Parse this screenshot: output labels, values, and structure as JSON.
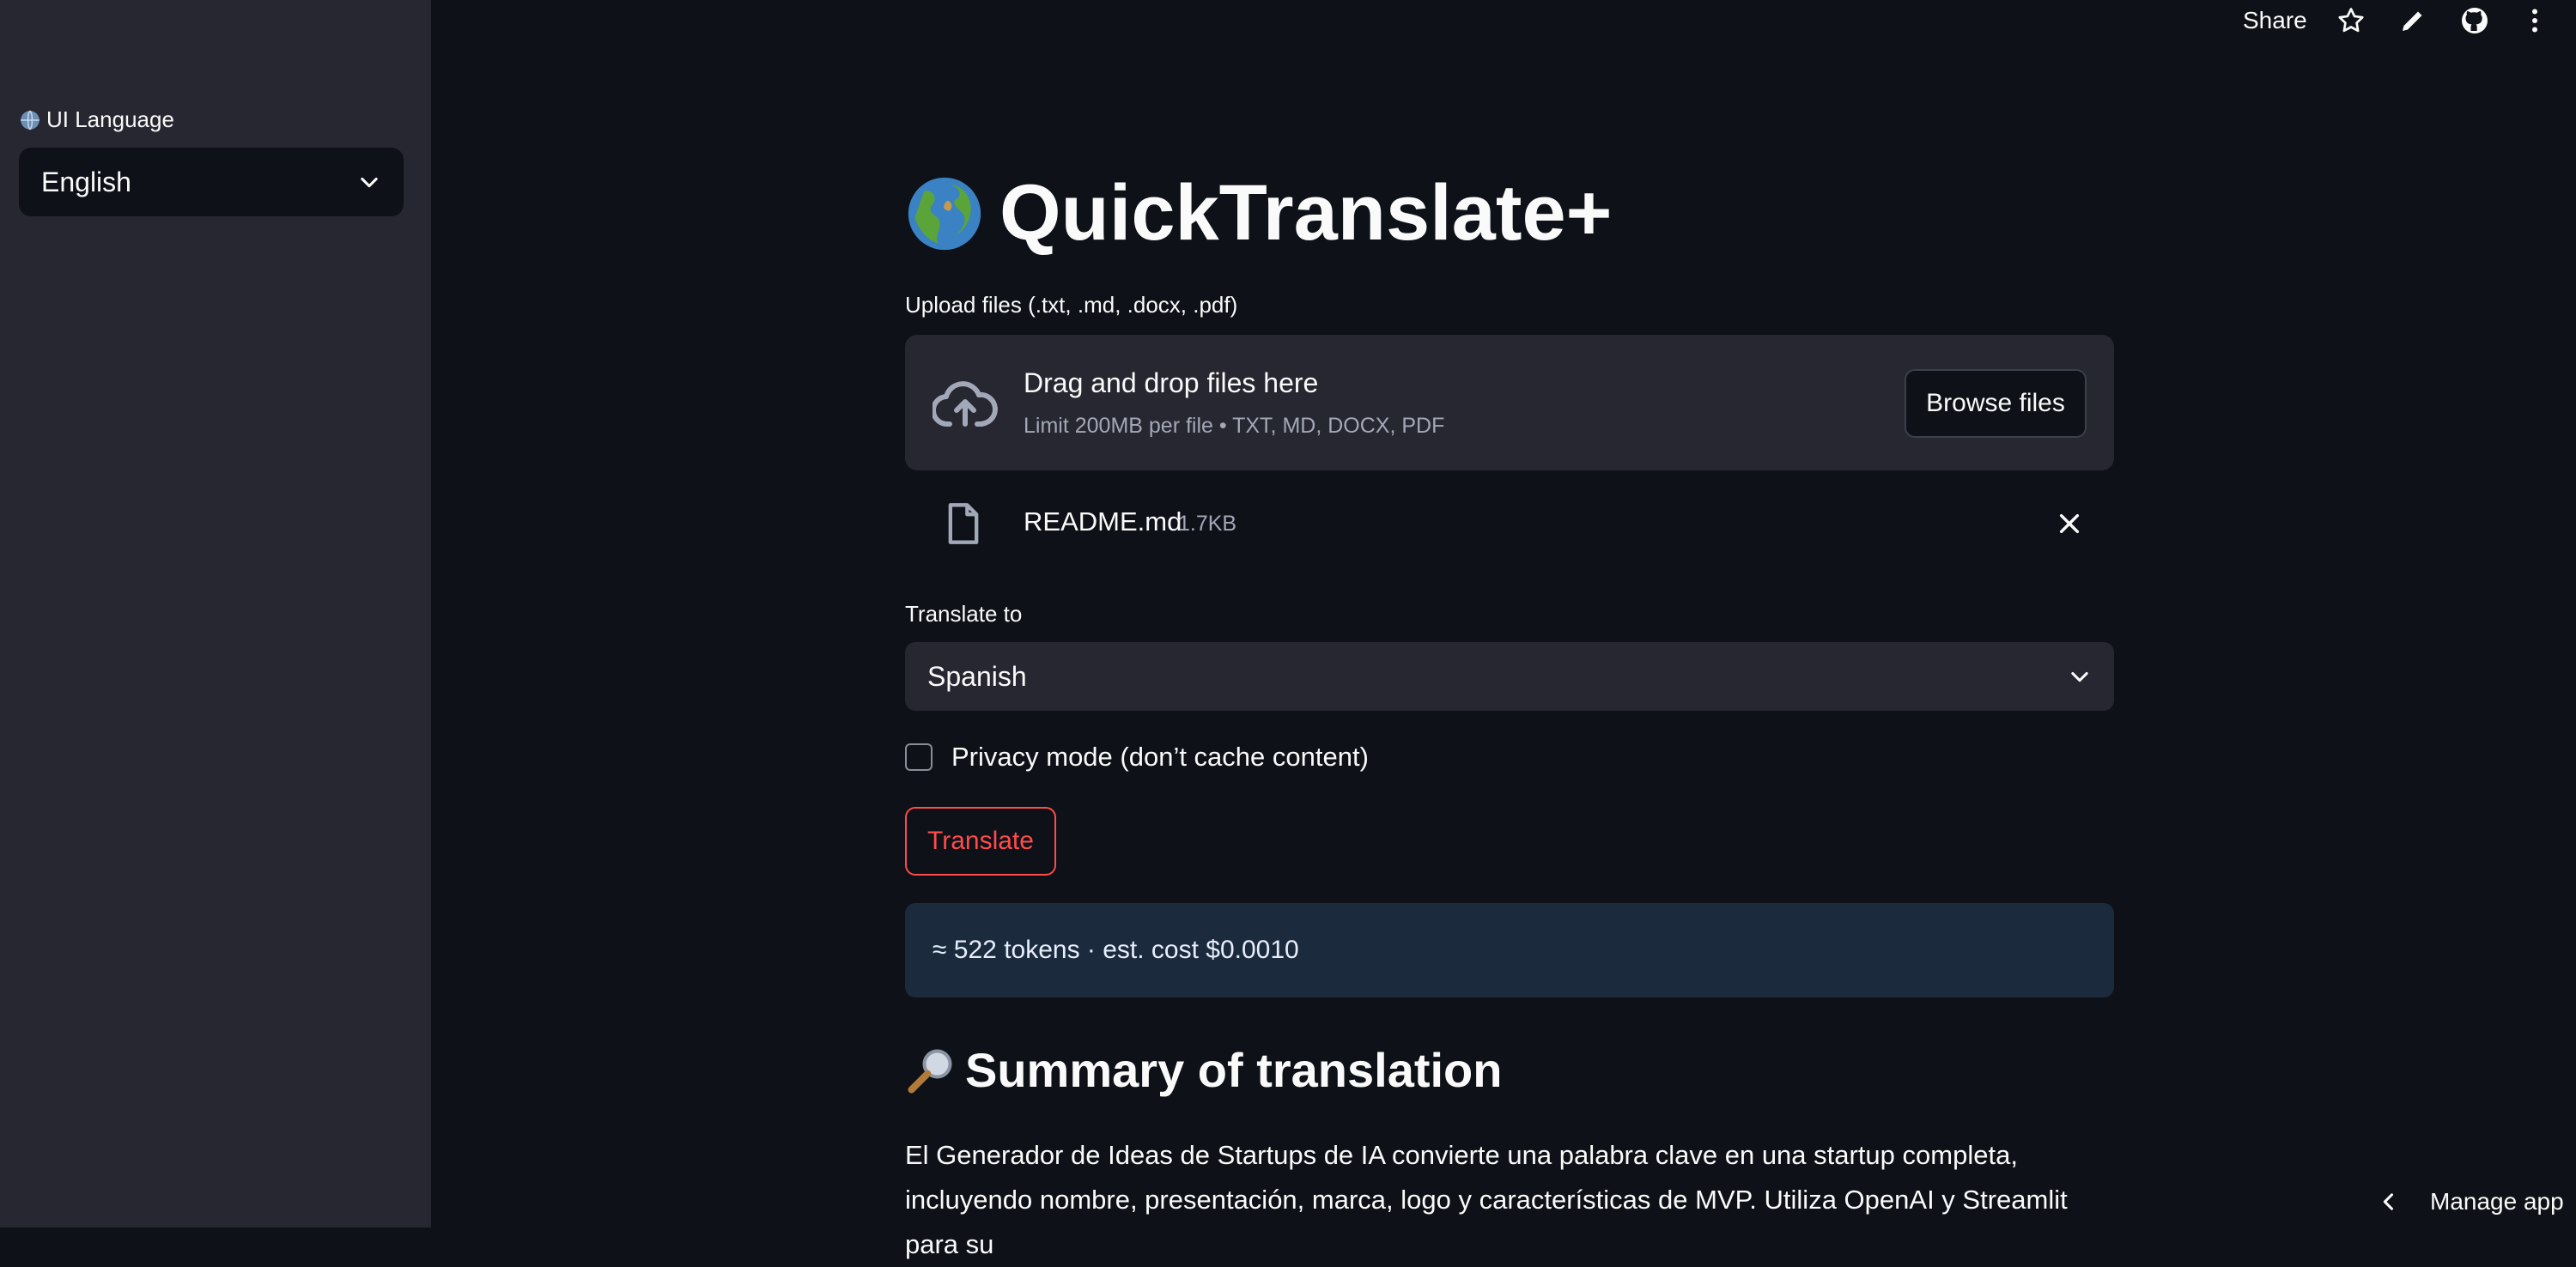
{
  "sidebar": {
    "language_label": "UI Language",
    "language_value": "English"
  },
  "toolbar": {
    "share_label": "Share"
  },
  "main": {
    "title": "QuickTranslate+",
    "upload_label": "Upload files (.txt, .md, .docx, .pdf)",
    "dropzone_title": "Drag and drop files here",
    "dropzone_subtitle": "Limit 200MB per file • TXT, MD, DOCX, PDF",
    "browse_label": "Browse files",
    "file": {
      "name": "README.md",
      "size": "1.7KB"
    },
    "translate_to_label": "Translate to",
    "translate_to_value": "Spanish",
    "privacy_label": "Privacy mode (don’t cache content)",
    "translate_button": "Translate",
    "estimate_text": "≈ 522 tokens · est. cost $0.0010",
    "summary_heading": "Summary of translation",
    "summary_text": "El Generador de Ideas de Startups de IA convierte una palabra clave en una startup completa, incluyendo nombre, presentación, marca, logo y características de MVP. Utiliza OpenAI y Streamlit para su"
  },
  "footer": {
    "manage_label": "Manage app"
  },
  "colors": {
    "background": "#0e1117",
    "sidebar": "#262730",
    "accent": "#ff4b4b",
    "info_bg": "#1c2a3e"
  }
}
